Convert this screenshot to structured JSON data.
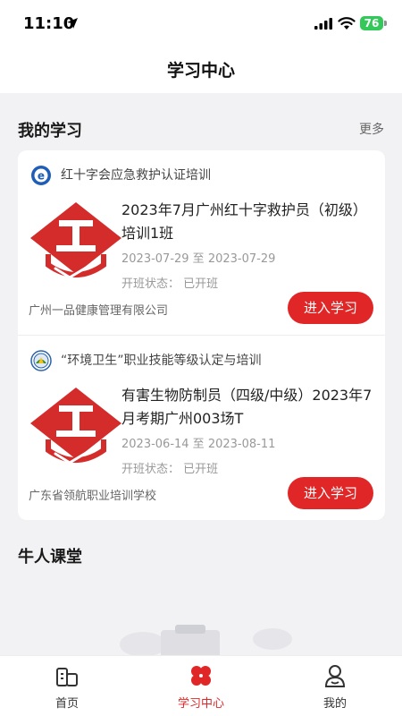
{
  "status_bar": {
    "time": "11:10",
    "battery": "76"
  },
  "header": {
    "title": "学习中心"
  },
  "my_study": {
    "title": "我的学习",
    "more": "更多",
    "items": [
      {
        "program": "红十字会应急救护认证培训",
        "title": "2023年7月广州红十字救护员（初级）培训1班",
        "date": "2023-07-29 至 2023-07-29",
        "status": "开班状态： 已开班",
        "org": "广州一品健康管理有限公司",
        "button": "进入学习"
      },
      {
        "program": "“环境卫生”职业技能等级认定与培训",
        "title": "有害生物防制员（四级/中级）2023年7月考期广州003场T",
        "date": "2023-06-14 至 2023-08-11",
        "status": "开班状态： 已开班",
        "org": "广东省领航职业培训学校",
        "button": "进入学习"
      }
    ]
  },
  "niu_class": {
    "title": "牛人课堂"
  },
  "tabs": [
    {
      "label": "首页",
      "icon": "home-building-icon"
    },
    {
      "label": "学习中心",
      "icon": "clover-icon"
    },
    {
      "label": "我的",
      "icon": "profile-icon"
    }
  ],
  "colors": {
    "accent": "#e02626",
    "battery": "#34c759"
  }
}
